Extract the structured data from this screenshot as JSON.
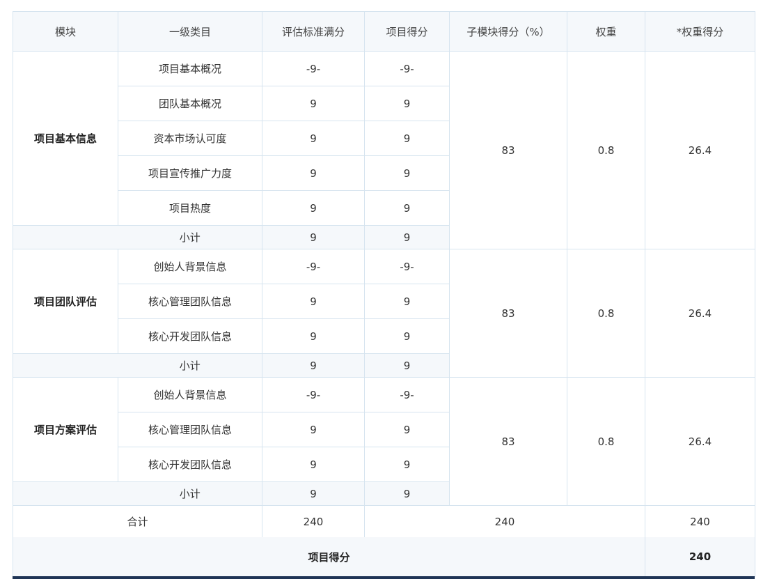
{
  "headers": [
    "模块",
    "一级类目",
    "评估标准满分",
    "项目得分",
    "子模块得分（%）",
    "权重",
    "*权重得分"
  ],
  "modules": [
    {
      "name": "项目基本信息",
      "rows": [
        {
          "category": "项目基本概况",
          "full": "-9-",
          "score": "-9-"
        },
        {
          "category": "团队基本概况",
          "full": "9",
          "score": "9"
        },
        {
          "category": "资本市场认可度",
          "full": "9",
          "score": "9"
        },
        {
          "category": "项目宣传推广力度",
          "full": "9",
          "score": "9"
        },
        {
          "category": "项目热度",
          "full": "9",
          "score": "9"
        }
      ],
      "subtotal": {
        "label": "小计",
        "full": "9",
        "score": "9"
      },
      "module_score": "83",
      "weight": "0.8",
      "weighted": "26.4"
    },
    {
      "name": "项目团队评估",
      "rows": [
        {
          "category": "创始人背景信息",
          "full": "-9-",
          "score": "-9-"
        },
        {
          "category": "核心管理团队信息",
          "full": "9",
          "score": "9"
        },
        {
          "category": "核心开发团队信息",
          "full": "9",
          "score": "9"
        }
      ],
      "subtotal": {
        "label": "小计",
        "full": "9",
        "score": "9"
      },
      "module_score": "83",
      "weight": "0.8",
      "weighted": "26.4"
    },
    {
      "name": "项目方案评估",
      "rows": [
        {
          "category": "创始人背景信息",
          "full": "-9-",
          "score": "-9-"
        },
        {
          "category": "核心管理团队信息",
          "full": "9",
          "score": "9"
        },
        {
          "category": "核心开发团队信息",
          "full": "9",
          "score": "9"
        }
      ],
      "subtotal": {
        "label": "小计",
        "full": "9",
        "score": "9"
      },
      "module_score": "83",
      "weight": "0.8",
      "weighted": "26.4"
    }
  ],
  "total": {
    "label": "合计",
    "full": "240",
    "module_score": "240",
    "weighted": "240"
  },
  "final": {
    "label": "项目得分",
    "value": "240"
  },
  "colors": {
    "header_bg": "#f5f8fb",
    "border": "#d6e4ef",
    "bottom_bar": "#1f3556"
  }
}
